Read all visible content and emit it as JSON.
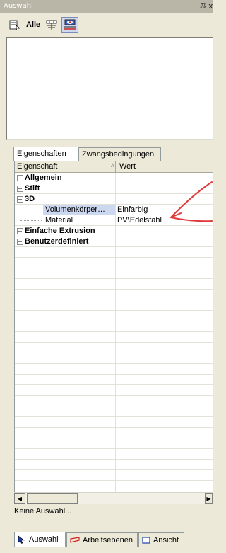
{
  "panel": {
    "title": "Auswahl",
    "pin_glyph": "ⅅ",
    "close_fragment": "x"
  },
  "toolbar": {
    "alle_label": "Alle",
    "icons": [
      "properties-icon",
      "filter-icon",
      "visibility-icon"
    ]
  },
  "tabs": [
    {
      "label": "Eigenschaften",
      "active": true
    },
    {
      "label": "Zwangsbedingungen",
      "active": false
    }
  ],
  "grid": {
    "columns": [
      "Eigenschaft",
      "Wert"
    ],
    "rows": [
      {
        "type": "category",
        "label": "Allgemein",
        "expanded": false
      },
      {
        "type": "category",
        "label": "Stift",
        "expanded": false
      },
      {
        "type": "category",
        "label": "3D",
        "expanded": true
      },
      {
        "type": "property",
        "label": "Volumenkörper…",
        "value": "Einfarbig",
        "selected": true
      },
      {
        "type": "property",
        "label": "Material",
        "value": "PV\\Edelstahl",
        "selected": false
      },
      {
        "type": "category",
        "label": "Einfache Extrusion",
        "expanded": false
      },
      {
        "type": "category",
        "label": "Benutzerdefiniert",
        "expanded": false
      }
    ]
  },
  "status": {
    "text": "Keine Auswahl..."
  },
  "bottom_tabs": [
    {
      "label": "Auswahl",
      "active": true,
      "icon": "cursor-icon"
    },
    {
      "label": "Arbeitsebenen",
      "active": false,
      "icon": "workplane-icon"
    },
    {
      "label": "Ansicht",
      "active": false,
      "icon": "view-icon"
    }
  ],
  "colors": {
    "annotation": "#e03a3a",
    "selected_row": "#ccd8f0",
    "titlebar": "#b9b6a8"
  }
}
